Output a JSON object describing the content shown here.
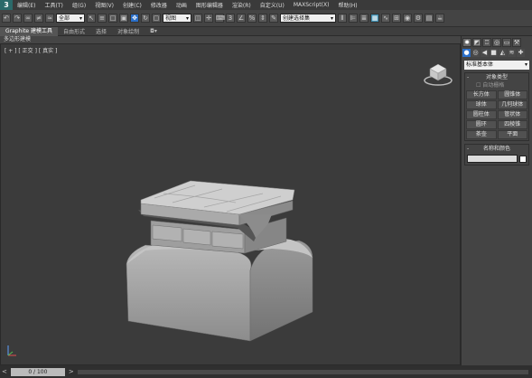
{
  "app": {
    "logo": "3"
  },
  "menu": [
    "编辑(E)",
    "工具(T)",
    "组(G)",
    "视图(V)",
    "创建(C)",
    "修改器",
    "动画",
    "图形编辑器",
    "渲染(R)",
    "自定义(U)",
    "MAXScript(X)",
    "帮助(H)"
  ],
  "toolbar": {
    "filter": "全部",
    "reference": "视图",
    "selection_set": "创建选择集"
  },
  "ribbon": {
    "tabs": [
      "Graphite 建模工具",
      "自由形式",
      "选择",
      "对象绘制"
    ],
    "active": "Graphite 建模工具",
    "sub": "多边形建模"
  },
  "viewport": {
    "label": "[ + ] [ 正交 ] [ 真实 ]"
  },
  "command_panel": {
    "category": "标准基本体",
    "object_type": {
      "title": "对象类型",
      "autogrid": "自动栅格",
      "buttons": [
        "长方体",
        "圆锥体",
        "球体",
        "几何球体",
        "圆柱体",
        "管状体",
        "圆环",
        "四棱锥",
        "茶壶",
        "平面"
      ]
    },
    "name_color": {
      "title": "名称和颜色"
    }
  },
  "timeline": {
    "position": "0 / 100"
  },
  "colors": {
    "viewport_bg": "#3b3b3b",
    "accent": "#2a6fc9",
    "model": "#a8a8a8"
  }
}
